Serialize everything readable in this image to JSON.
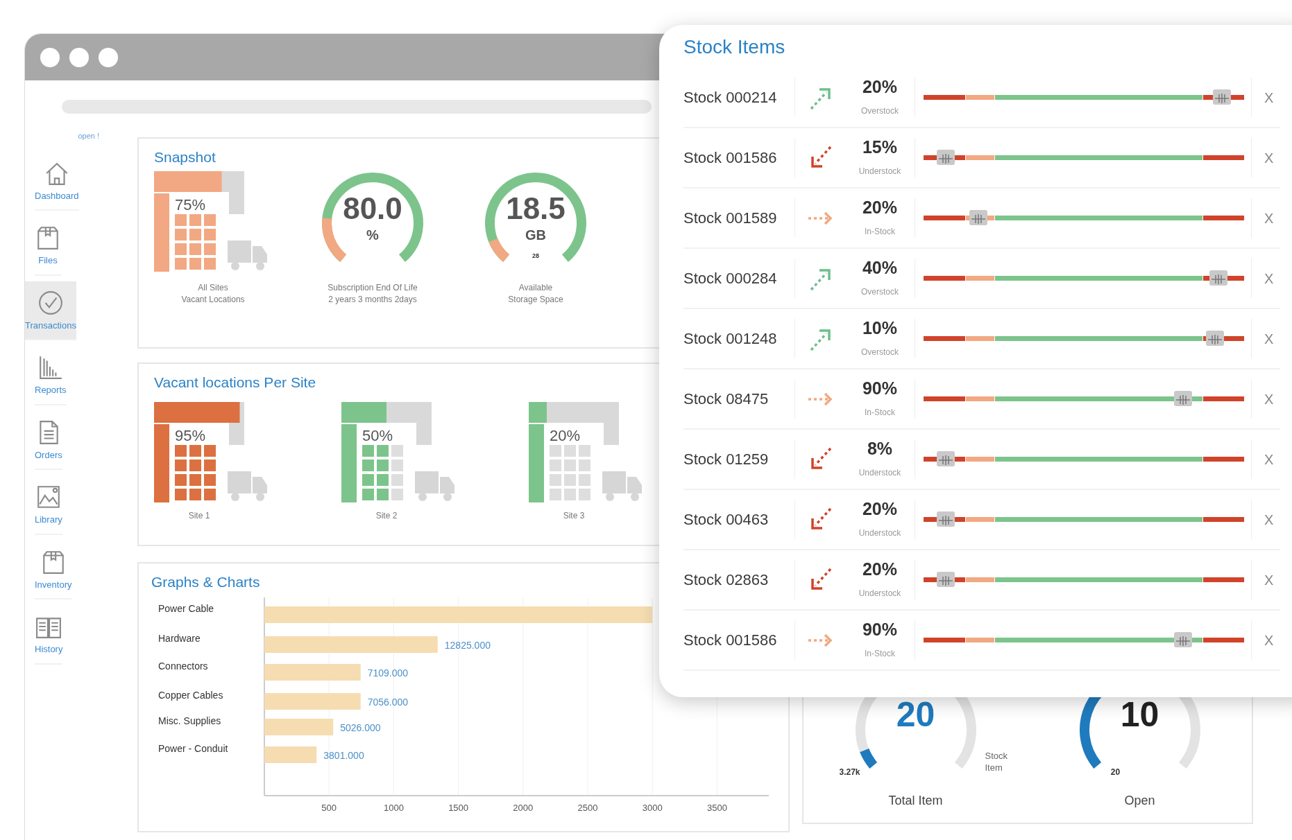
{
  "sidebar": {
    "top_link": "open !",
    "items": [
      {
        "label": "Dashboard",
        "kind": "house",
        "selected": false
      },
      {
        "label": "Files",
        "kind": "box",
        "selected": false
      },
      {
        "label": "Transactions",
        "kind": "check",
        "selected": true
      },
      {
        "label": "Reports",
        "kind": "bars",
        "selected": false
      },
      {
        "label": "Orders",
        "kind": "document",
        "selected": false
      },
      {
        "label": "Library",
        "kind": "picture",
        "selected": false
      },
      {
        "label": "Inventory",
        "kind": "box",
        "selected": false
      },
      {
        "label": "History",
        "kind": "book",
        "selected": false
      }
    ]
  },
  "snapshot": {
    "title": "Snapshot",
    "widgets": [
      {
        "kind": "building",
        "value": "75%",
        "level": 0.75,
        "color": "#f2a882",
        "caption": [
          "All Sites",
          "Vacant Locations"
        ]
      },
      {
        "kind": "gauge",
        "value": "80.0",
        "unit": "%",
        "level": 0.2,
        "caption": [
          "Subscription End Of Life",
          "2 years 3 months 2days"
        ]
      },
      {
        "kind": "gauge",
        "value": "18.5",
        "unit": "GB",
        "min_label": "28",
        "level": 0.1,
        "caption": [
          "Available",
          "Storage Space"
        ]
      }
    ]
  },
  "vacant_locations": {
    "title": "Vacant locations Per Site",
    "sites": [
      {
        "value": "95%",
        "level": 0.95,
        "color": "#dc7040",
        "label": "Site 1"
      },
      {
        "value": "50%",
        "level": 0.5,
        "color": "#7cc48c",
        "label": "Site 2"
      },
      {
        "value": "20%",
        "level": 0.2,
        "color": "#7cc48c",
        "label": "Site 3"
      }
    ]
  },
  "graphs": {
    "title": "Graphs & Charts",
    "chart_data": {
      "type": "bar",
      "orientation": "horizontal",
      "categories": [
        "Power Cable",
        "Hardware",
        "Connectors",
        "Copper Cables",
        "Misc. Supplies",
        "Power - Conduit"
      ],
      "values": [
        3000,
        1340,
        744,
        744,
        532,
        404
      ],
      "xlim": [
        0,
        3900
      ],
      "xticks": [
        500,
        1000,
        1500,
        2000,
        2500,
        3000,
        3500
      ],
      "grid": true,
      "annotations": [
        {
          "x": 1340,
          "y": "Hardware",
          "text": "12825.000"
        },
        {
          "x": 744,
          "y": "Connectors",
          "text": "7109.000"
        },
        {
          "x": 744,
          "y": "Copper Cables",
          "text": "7056.000"
        },
        {
          "x": 532,
          "y": "Misc. Supplies",
          "text": "5026.000"
        },
        {
          "x": 404,
          "y": "Power - Conduit",
          "text": "3801.000"
        }
      ]
    }
  },
  "summary": {
    "gauges": [
      {
        "value": "20",
        "highlighted": true,
        "sub_label": "3.27k",
        "side_label": "Stock Item",
        "caption": "Total Item",
        "level": 0.07
      },
      {
        "value": "10",
        "highlighted": false,
        "sub_label": "20",
        "caption": "Open",
        "level": 0.5
      }
    ]
  },
  "stock_items": {
    "title": "Stock Items",
    "rows": [
      {
        "name": "Stock 000214",
        "kind": "up",
        "percent": "20%",
        "status": "Overstock",
        "level": 0.93,
        "close": "X"
      },
      {
        "name": "Stock 001586",
        "kind": "down",
        "percent": "15%",
        "status": "Understock",
        "level": 0.07,
        "close": "X"
      },
      {
        "name": "Stock 001589",
        "kind": "flat",
        "percent": "20%",
        "status": "In-Stock",
        "level": 0.17,
        "close": "X"
      },
      {
        "name": "Stock 000284",
        "kind": "up",
        "percent": "40%",
        "status": "Overstock",
        "level": 0.92,
        "close": "X"
      },
      {
        "name": "Stock 001248",
        "kind": "up",
        "percent": "10%",
        "status": "Overstock",
        "level": 0.91,
        "close": "X"
      },
      {
        "name": "Stock 08475",
        "kind": "flat",
        "percent": "90%",
        "status": "In-Stock",
        "level": 0.81,
        "close": "X"
      },
      {
        "name": "Stock 01259",
        "kind": "down",
        "percent": "8%",
        "status": "Understock",
        "level": 0.07,
        "close": "X"
      },
      {
        "name": "Stock 00463",
        "kind": "down",
        "percent": "20%",
        "status": "Understock",
        "level": 0.07,
        "close": "X"
      },
      {
        "name": "Stock 02863",
        "kind": "down",
        "percent": "20%",
        "status": "Understock",
        "level": 0.07,
        "close": "X"
      },
      {
        "name": "Stock 001586",
        "kind": "flat",
        "percent": "90%",
        "status": "In-Stock",
        "level": 0.81,
        "close": "X"
      }
    ]
  }
}
